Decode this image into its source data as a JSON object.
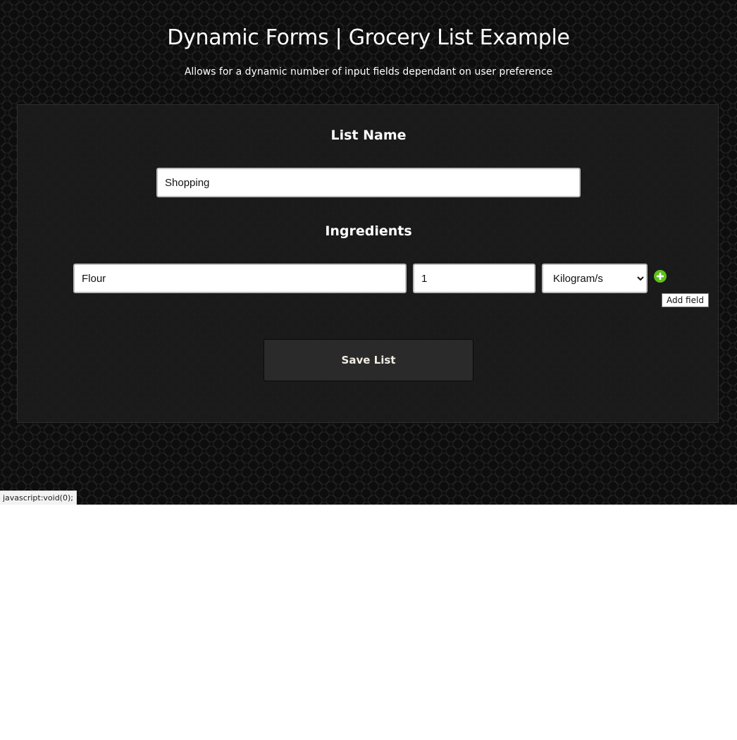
{
  "header": {
    "title": "Dynamic Forms | Grocery List Example",
    "subtitle": "Allows for a dynamic number of input fields dependant on user preference"
  },
  "form": {
    "list_name_label": "List Name",
    "list_name_value": "Shopping",
    "ingredients_label": "Ingredients",
    "ingredients": [
      {
        "name": "Flour",
        "quantity": "1",
        "unit": "Kilogram/s"
      }
    ],
    "add_field_icon": "plus-circle-icon",
    "add_field_tooltip": "Add field",
    "save_label": "Save List"
  },
  "status_bar": {
    "link_url": "javascript:void(0);"
  },
  "colors": {
    "background": "#0d0d0d",
    "panel": "#1c1c1c",
    "add_button": "#5fbf1f",
    "save_button": "#2a2a2a",
    "save_text": "#f0ede4"
  }
}
